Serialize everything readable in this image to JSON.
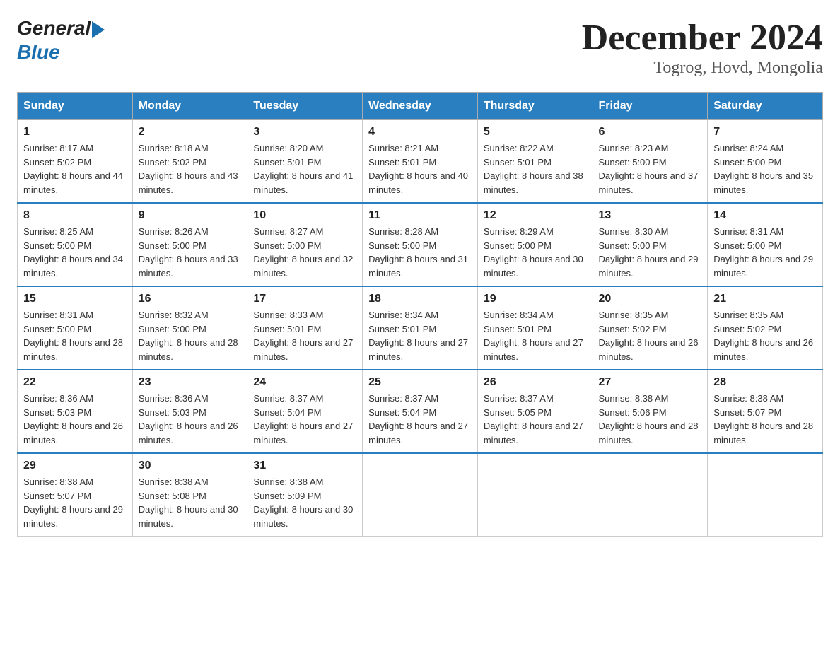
{
  "header": {
    "logo_general": "General",
    "logo_blue": "Blue",
    "title": "December 2024",
    "subtitle": "Togrog, Hovd, Mongolia"
  },
  "days_of_week": [
    "Sunday",
    "Monday",
    "Tuesday",
    "Wednesday",
    "Thursday",
    "Friday",
    "Saturday"
  ],
  "weeks": [
    [
      {
        "day": "1",
        "sunrise": "8:17 AM",
        "sunset": "5:02 PM",
        "daylight": "8 hours and 44 minutes."
      },
      {
        "day": "2",
        "sunrise": "8:18 AM",
        "sunset": "5:02 PM",
        "daylight": "8 hours and 43 minutes."
      },
      {
        "day": "3",
        "sunrise": "8:20 AM",
        "sunset": "5:01 PM",
        "daylight": "8 hours and 41 minutes."
      },
      {
        "day": "4",
        "sunrise": "8:21 AM",
        "sunset": "5:01 PM",
        "daylight": "8 hours and 40 minutes."
      },
      {
        "day": "5",
        "sunrise": "8:22 AM",
        "sunset": "5:01 PM",
        "daylight": "8 hours and 38 minutes."
      },
      {
        "day": "6",
        "sunrise": "8:23 AM",
        "sunset": "5:00 PM",
        "daylight": "8 hours and 37 minutes."
      },
      {
        "day": "7",
        "sunrise": "8:24 AM",
        "sunset": "5:00 PM",
        "daylight": "8 hours and 35 minutes."
      }
    ],
    [
      {
        "day": "8",
        "sunrise": "8:25 AM",
        "sunset": "5:00 PM",
        "daylight": "8 hours and 34 minutes."
      },
      {
        "day": "9",
        "sunrise": "8:26 AM",
        "sunset": "5:00 PM",
        "daylight": "8 hours and 33 minutes."
      },
      {
        "day": "10",
        "sunrise": "8:27 AM",
        "sunset": "5:00 PM",
        "daylight": "8 hours and 32 minutes."
      },
      {
        "day": "11",
        "sunrise": "8:28 AM",
        "sunset": "5:00 PM",
        "daylight": "8 hours and 31 minutes."
      },
      {
        "day": "12",
        "sunrise": "8:29 AM",
        "sunset": "5:00 PM",
        "daylight": "8 hours and 30 minutes."
      },
      {
        "day": "13",
        "sunrise": "8:30 AM",
        "sunset": "5:00 PM",
        "daylight": "8 hours and 29 minutes."
      },
      {
        "day": "14",
        "sunrise": "8:31 AM",
        "sunset": "5:00 PM",
        "daylight": "8 hours and 29 minutes."
      }
    ],
    [
      {
        "day": "15",
        "sunrise": "8:31 AM",
        "sunset": "5:00 PM",
        "daylight": "8 hours and 28 minutes."
      },
      {
        "day": "16",
        "sunrise": "8:32 AM",
        "sunset": "5:00 PM",
        "daylight": "8 hours and 28 minutes."
      },
      {
        "day": "17",
        "sunrise": "8:33 AM",
        "sunset": "5:01 PM",
        "daylight": "8 hours and 27 minutes."
      },
      {
        "day": "18",
        "sunrise": "8:34 AM",
        "sunset": "5:01 PM",
        "daylight": "8 hours and 27 minutes."
      },
      {
        "day": "19",
        "sunrise": "8:34 AM",
        "sunset": "5:01 PM",
        "daylight": "8 hours and 27 minutes."
      },
      {
        "day": "20",
        "sunrise": "8:35 AM",
        "sunset": "5:02 PM",
        "daylight": "8 hours and 26 minutes."
      },
      {
        "day": "21",
        "sunrise": "8:35 AM",
        "sunset": "5:02 PM",
        "daylight": "8 hours and 26 minutes."
      }
    ],
    [
      {
        "day": "22",
        "sunrise": "8:36 AM",
        "sunset": "5:03 PM",
        "daylight": "8 hours and 26 minutes."
      },
      {
        "day": "23",
        "sunrise": "8:36 AM",
        "sunset": "5:03 PM",
        "daylight": "8 hours and 26 minutes."
      },
      {
        "day": "24",
        "sunrise": "8:37 AM",
        "sunset": "5:04 PM",
        "daylight": "8 hours and 27 minutes."
      },
      {
        "day": "25",
        "sunrise": "8:37 AM",
        "sunset": "5:04 PM",
        "daylight": "8 hours and 27 minutes."
      },
      {
        "day": "26",
        "sunrise": "8:37 AM",
        "sunset": "5:05 PM",
        "daylight": "8 hours and 27 minutes."
      },
      {
        "day": "27",
        "sunrise": "8:38 AM",
        "sunset": "5:06 PM",
        "daylight": "8 hours and 28 minutes."
      },
      {
        "day": "28",
        "sunrise": "8:38 AM",
        "sunset": "5:07 PM",
        "daylight": "8 hours and 28 minutes."
      }
    ],
    [
      {
        "day": "29",
        "sunrise": "8:38 AM",
        "sunset": "5:07 PM",
        "daylight": "8 hours and 29 minutes."
      },
      {
        "day": "30",
        "sunrise": "8:38 AM",
        "sunset": "5:08 PM",
        "daylight": "8 hours and 30 minutes."
      },
      {
        "day": "31",
        "sunrise": "8:38 AM",
        "sunset": "5:09 PM",
        "daylight": "8 hours and 30 minutes."
      },
      null,
      null,
      null,
      null
    ]
  ],
  "labels": {
    "sunrise": "Sunrise:",
    "sunset": "Sunset:",
    "daylight": "Daylight:"
  }
}
